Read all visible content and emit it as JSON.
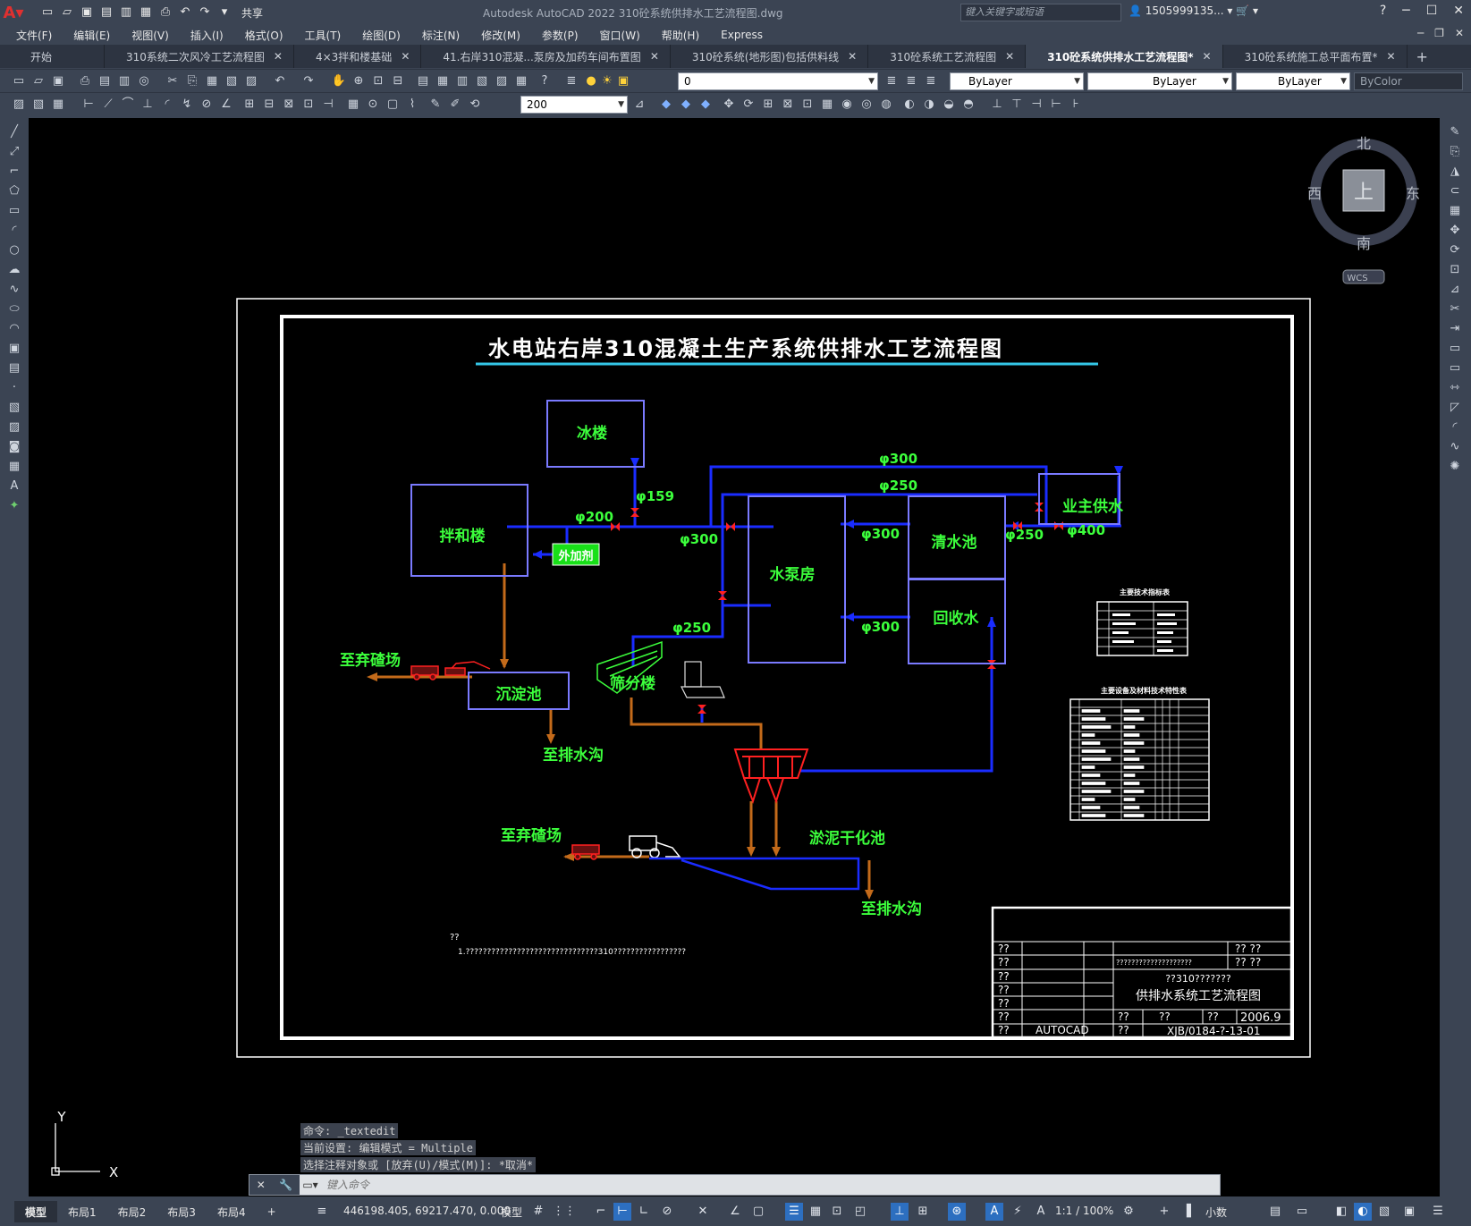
{
  "titlebar": {
    "app_title": "Autodesk AutoCAD 2022    310砼系统供排水工艺流程图.dwg",
    "share": "共享",
    "search_placeholder": "键入关键字或短语",
    "user": "1505999135..."
  },
  "menu": [
    "文件(F)",
    "编辑(E)",
    "视图(V)",
    "插入(I)",
    "格式(O)",
    "工具(T)",
    "绘图(D)",
    "标注(N)",
    "修改(M)",
    "参数(P)",
    "窗口(W)",
    "帮助(H)",
    "Express"
  ],
  "tabs": [
    {
      "label": "开始",
      "active": false
    },
    {
      "label": "310系统二次风冷工艺流程图",
      "active": false
    },
    {
      "label": "4×3拌和楼基础",
      "active": false
    },
    {
      "label": "41.右岸310混凝...泵房及加药车间布置图",
      "active": false
    },
    {
      "label": "310砼系统(地形图)包括供料线",
      "active": false
    },
    {
      "label": "310砼系统工艺流程图",
      "active": false
    },
    {
      "label": "310砼系统供排水工艺流程图*",
      "active": true
    },
    {
      "label": "310砼系统施工总平面布置*",
      "active": false
    }
  ],
  "toolbar": {
    "layer": "0",
    "color": "ByLayer",
    "linetype": "ByLayer",
    "lineweight": "ByLayer",
    "plotstyle": "ByColor",
    "dimscale": "200"
  },
  "viewcube": {
    "north": "北",
    "south": "南",
    "east": "东",
    "west": "西",
    "top": "上",
    "wcs": "WCS"
  },
  "drawing": {
    "title": "水电站右岸310混凝土生产系统供排水工艺流程图",
    "boxes": {
      "ice": "冰楼",
      "mixer": "拌和楼",
      "additive": "外加剂",
      "pump": "水泵房",
      "clear": "清水池",
      "recycle": "回收水",
      "settle": "沉淀池",
      "owner": "业主供水"
    },
    "pipes": {
      "p300a": "φ300",
      "p250a": "φ250",
      "p159": "φ159",
      "p200": "φ200",
      "p300b": "φ300",
      "p300c": "φ300",
      "p250b": "φ250",
      "p400": "φ400",
      "p300d": "φ300",
      "p250c": "φ250"
    },
    "labels": {
      "screen": "筛分楼",
      "dump1": "至弃碴场",
      "drain1": "至排水沟",
      "dump2": "至弃碴场",
      "sludge": "淤泥干化池",
      "drain2": "至排水沟"
    },
    "tables": {
      "tech": "主要技术指标表",
      "equip": "主要设备及材料技术特性表"
    },
    "notes": {
      "head": "??",
      "line1": "1.???????????????????????????????310?????????????????"
    },
    "titleblock": {
      "r1c1": "??",
      "r1c5": "?? ??",
      "r2c1": "??",
      "r2mid": "????????????????????",
      "r2c5": "?? ??",
      "r3c1": "??",
      "r3proj": "??310???????",
      "r4c1": "??",
      "r4name": "供排水系统工艺流程图",
      "r5c1": "??",
      "r6c1": "??",
      "r6a": "??",
      "r6b": "??",
      "r6c": "??",
      "r6date": "2006.9",
      "r7c1": "??",
      "r7sw": "AUTOCAD",
      "r7a": "??",
      "r7num": "XJB/0184-?-13-01"
    }
  },
  "ucs": {
    "x": "X",
    "y": "Y"
  },
  "command": {
    "h1": "命令: _textedit",
    "h2": "当前设置: 编辑模式 = Multiple",
    "h3": "选择注释对象或 [放弃(U)/模式(M)]: *取消*",
    "placeholder": "键入命令"
  },
  "status": {
    "layouts": [
      "模型",
      "布局1",
      "布局2",
      "布局3",
      "布局4"
    ],
    "coords": "446198.405, 69217.470, 0.000",
    "model": "模型",
    "scale": "1:1 / 100%",
    "units": "小数"
  }
}
